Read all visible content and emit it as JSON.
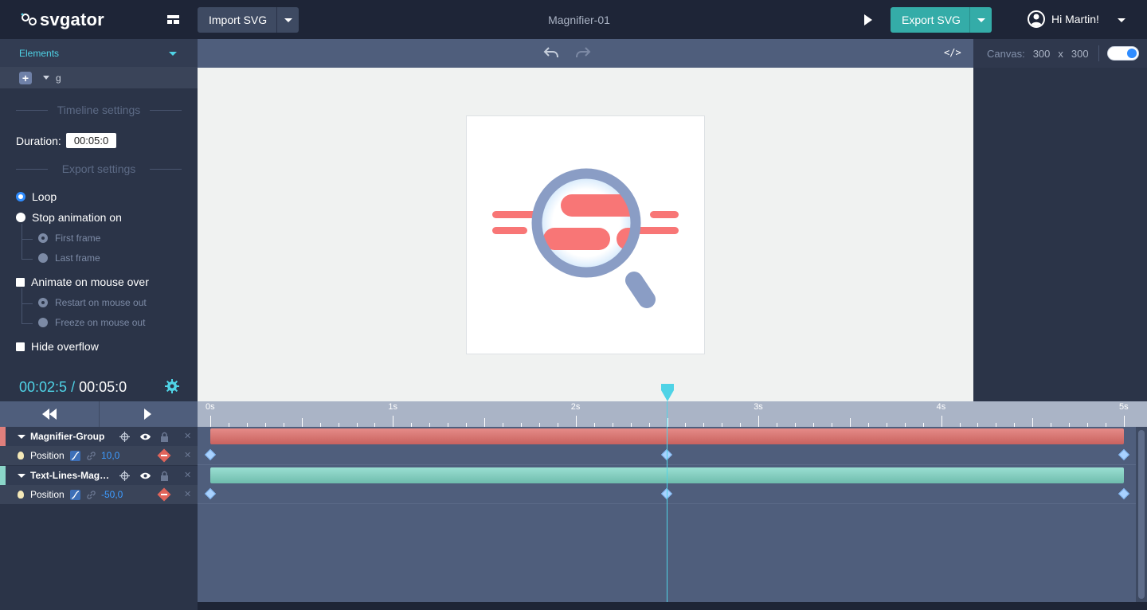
{
  "app": {
    "logo": "svgator",
    "document_title": "Magnifier-01",
    "import_label": "Import SVG",
    "export_label": "Export SVG",
    "user_greeting": "Hi Martin!"
  },
  "elements_panel": {
    "title": "Elements",
    "root_node": "g",
    "timeline_settings_title": "Timeline settings",
    "duration_label": "Duration:",
    "duration_value": "00:05:0",
    "export_settings_title": "Export settings",
    "loop_label": "Loop",
    "stop_label": "Stop animation on",
    "first_frame_label": "First frame",
    "last_frame_label": "Last frame",
    "animate_mouse_label": "Animate on mouse over",
    "restart_label": "Restart on mouse out",
    "freeze_label": "Freeze on mouse out",
    "hide_overflow_label": "Hide overflow",
    "current_time": "00:02:5",
    "separator": " / ",
    "total_time": "00:05:0"
  },
  "stage": {
    "code_label": "</>"
  },
  "canvas_panel": {
    "label": "Canvas:",
    "width": "300",
    "times": "x",
    "height": "300"
  },
  "timeline": {
    "ticks": [
      "0s",
      "1s",
      "2s",
      "3s",
      "4s",
      "5s"
    ],
    "layers": [
      {
        "name": "Magnifier-Group",
        "color": "#e07f7c",
        "bar_color": "#d2716e",
        "property": "Position",
        "value": "10,0"
      },
      {
        "name": "Text-Lines-Magnifier",
        "color": "#8bd6c9",
        "bar_color": "#7fcbbb",
        "property": "Position",
        "value": "-50,0"
      }
    ]
  },
  "colors": {
    "accent": "#4fd3e6",
    "export": "#34aca8",
    "magnifier": "#8a9dc5",
    "text_lines": "#f87676"
  }
}
